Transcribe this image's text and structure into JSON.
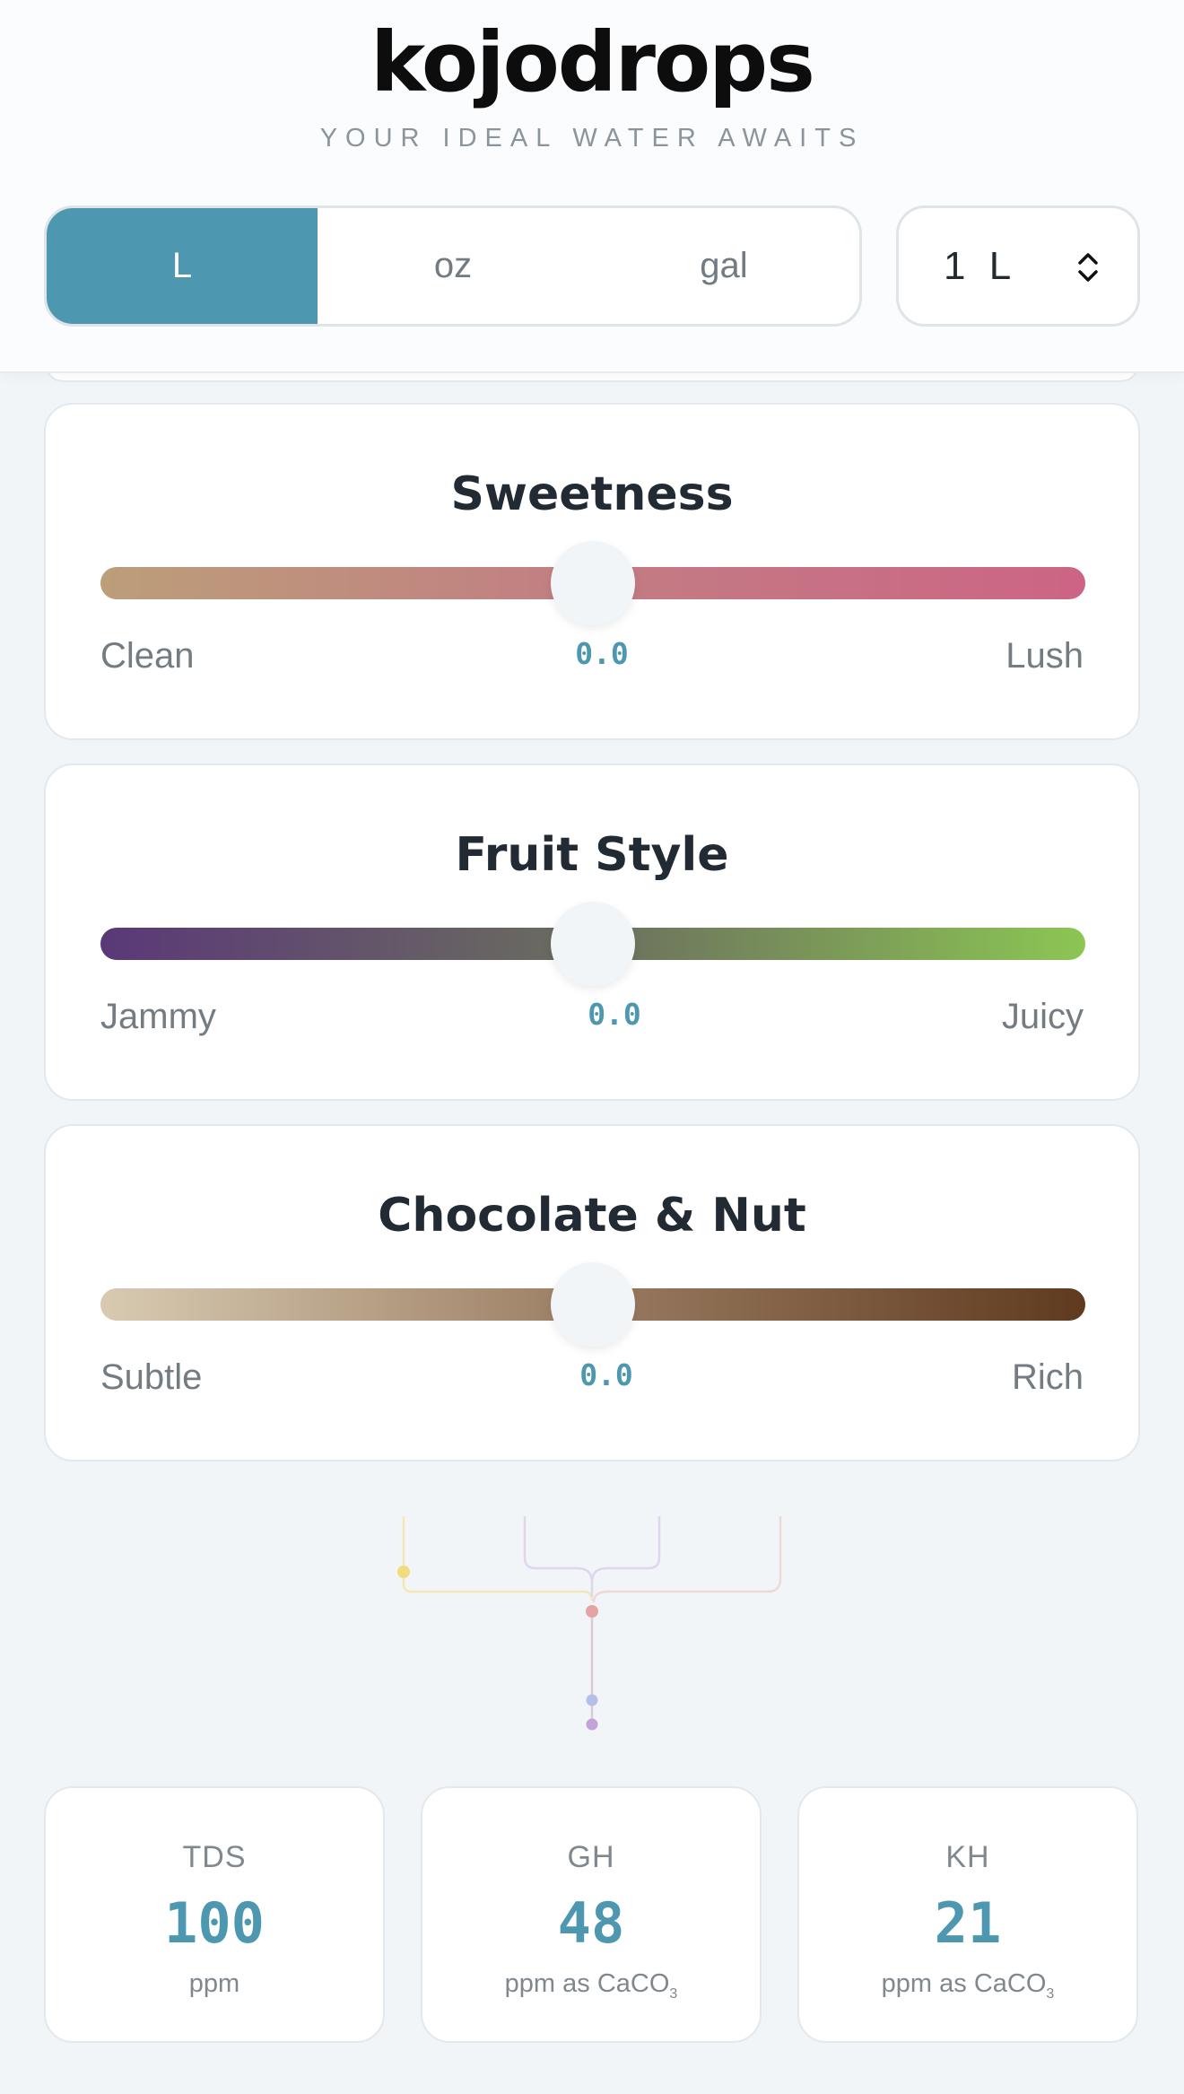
{
  "brand": {
    "logo": "kojodrops",
    "tagline": "YOUR IDEAL WATER AWAITS"
  },
  "units": {
    "options": [
      "L",
      "oz",
      "gal"
    ],
    "selected": "L"
  },
  "volume": {
    "value": "1 L"
  },
  "sliders": [
    {
      "title": "Sweetness",
      "min_label": "Clean",
      "max_label": "Lush",
      "value": "0.0",
      "position_fraction": 0.5,
      "gradient": [
        "#bc9e79",
        "#c27d83",
        "#cd6485"
      ]
    },
    {
      "title": "Fruit Style",
      "min_label": "Jammy",
      "max_label": "Juicy",
      "value": "0.0",
      "position_fraction": 0.5,
      "gradient": [
        "#5a3878",
        "#6b6e5e",
        "#8cc653"
      ]
    },
    {
      "title": "Chocolate & Nut",
      "min_label": "Subtle",
      "max_label": "Rich",
      "value": "0.0",
      "position_fraction": 0.5,
      "gradient": [
        "#d8cbb2",
        "#9a7c62",
        "#5f3a1e"
      ]
    }
  ],
  "stats": [
    {
      "label": "TDS",
      "value": "100",
      "unit": "ppm",
      "unit_sub": ""
    },
    {
      "label": "GH",
      "value": "48",
      "unit": "ppm as CaCO",
      "unit_sub": "3"
    },
    {
      "label": "KH",
      "value": "21",
      "unit": "ppm as CaCO",
      "unit_sub": "3"
    }
  ],
  "colors": {
    "accent": "#4d98b0",
    "background": "#f1f5f8",
    "card": "#ffffff",
    "dot_yellow": "#f0dc7a",
    "dot_red": "#e5a3a3",
    "dot_blue": "#b3bfe6",
    "dot_purple": "#c2a3dc"
  }
}
